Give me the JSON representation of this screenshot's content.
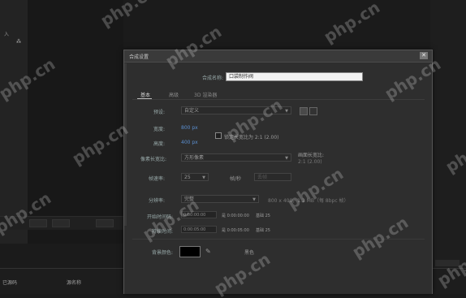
{
  "background_app": {
    "panel_label": "入",
    "panel_icon": "network-icon",
    "timeline_label_1": "已源码",
    "timeline_label_2": "源名称"
  },
  "dialog": {
    "title": "合成设置",
    "close_glyph": "✕",
    "name_label": "合成名称:",
    "name_value": "口袋制作阀",
    "tabs": [
      "基本",
      "高级",
      "3D 渲染器"
    ],
    "active_tab": 0,
    "preset_label": "预设:",
    "preset_value": "自定义",
    "width_label": "宽度:",
    "width_value": "800 px",
    "height_label": "高度:",
    "height_value": "400 px",
    "lock_aspect_label": "锁定长宽比为 2:1 (2.00)",
    "pixel_aspect_label": "像素长宽比:",
    "pixel_aspect_value": "方形像素",
    "frame_aspect_label": "画面长宽比:",
    "frame_aspect_value": "2:1 (2.00)",
    "frame_rate_label": "帧速率:",
    "frame_rate_value": "25",
    "frame_rate_suffix": "帧/秒",
    "drop_frame_value": "丢帧",
    "resolution_label": "分辨率:",
    "resolution_value": "完整",
    "resolution_info": "800 x 400，1.2 MB（每 8bpc 帧）",
    "start_timecode_label": "开始时间码:",
    "start_timecode_value": "0:00:00:00",
    "start_timecode_info": "是 0:00:00:00",
    "start_timecode_base": "基础 25",
    "duration_label": "持续时间:",
    "duration_value": "0:00:05:00",
    "duration_info": "是 0:00:05:00",
    "duration_base": "基础 25",
    "bg_color_label": "背景颜色:",
    "bg_color": "#000000",
    "bg_color_name": "黑色",
    "eyedropper_icon": "eyedropper-icon"
  },
  "watermark": "php.cn"
}
